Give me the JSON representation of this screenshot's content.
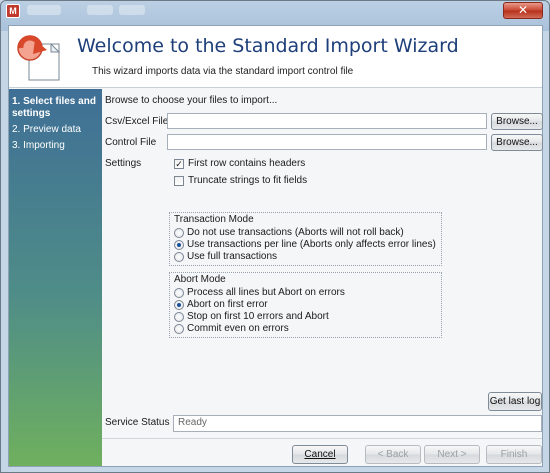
{
  "window": {
    "app_icon_letter": "M",
    "close_glyph": "✕"
  },
  "header": {
    "title": "Welcome to the Standard Import Wizard",
    "subtitle": "This wizard imports data via the standard import control file"
  },
  "sidebar": {
    "steps": [
      {
        "label": "1. Select files and settings",
        "active": true
      },
      {
        "label": "2. Preview data",
        "active": false
      },
      {
        "label": "3. Importing",
        "active": false
      }
    ]
  },
  "main": {
    "instructions": "Browse to choose your files to import...",
    "csv_label": "Csv/Excel File",
    "csv_value": "",
    "control_label": "Control File",
    "control_value": "",
    "browse_label": "Browse...",
    "settings_label": "Settings",
    "first_row_headers": {
      "label": "First row contains headers",
      "checked": true
    },
    "truncate_strings": {
      "label": "Truncate strings to fit fields",
      "checked": false
    },
    "transaction_mode": {
      "title": "Transaction Mode",
      "options": [
        {
          "label": "Do not use transactions (Aborts will not roll back)",
          "selected": false
        },
        {
          "label": "Use transactions per line (Aborts only affects error lines)",
          "selected": true
        },
        {
          "label": "Use full transactions",
          "selected": false
        }
      ]
    },
    "abort_mode": {
      "title": "Abort Mode",
      "options": [
        {
          "label": "Process all lines but Abort on errors",
          "selected": false
        },
        {
          "label": "Abort on first error",
          "selected": true
        },
        {
          "label": "Stop on first 10 errors and Abort",
          "selected": false
        },
        {
          "label": "Commit even on errors",
          "selected": false
        }
      ]
    },
    "get_last_log_label": "Get last log",
    "service_status_label": "Service Status",
    "service_status_value": "Ready"
  },
  "footer": {
    "cancel_label": "Cancel",
    "back_label": "< Back",
    "next_label": "Next >",
    "finish_label": "Finish"
  },
  "colors": {
    "title_text": "#1e3f7a",
    "sidebar_top": "#3f6f96",
    "sidebar_bottom": "#6fb05e",
    "wizard_icon_arrow": "#d9482b"
  }
}
